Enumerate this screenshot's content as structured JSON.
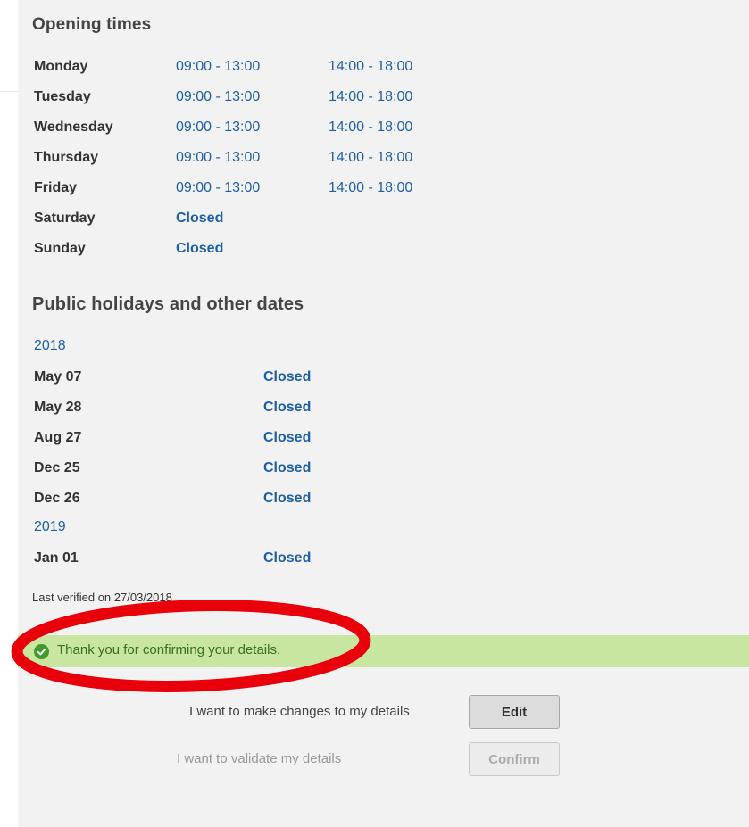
{
  "opening_times": {
    "title": "Opening times",
    "days": [
      {
        "day": "Monday",
        "morning": "09:00 - 13:00",
        "afternoon": "14:00 - 18:00"
      },
      {
        "day": "Tuesday",
        "morning": "09:00 - 13:00",
        "afternoon": "14:00 - 18:00"
      },
      {
        "day": "Wednesday",
        "morning": "09:00 - 13:00",
        "afternoon": "14:00 - 18:00"
      },
      {
        "day": "Thursday",
        "morning": "09:00 - 13:00",
        "afternoon": "14:00 - 18:00"
      },
      {
        "day": "Friday",
        "morning": "09:00 - 13:00",
        "afternoon": "14:00 - 18:00"
      },
      {
        "day": "Saturday",
        "status": "Closed"
      },
      {
        "day": "Sunday",
        "status": "Closed"
      }
    ]
  },
  "public_holidays": {
    "title": "Public holidays and other dates",
    "years": [
      {
        "year": "2018",
        "dates": [
          {
            "date": "May 07",
            "status": "Closed"
          },
          {
            "date": "May 28",
            "status": "Closed"
          },
          {
            "date": "Aug 27",
            "status": "Closed"
          },
          {
            "date": "Dec 25",
            "status": "Closed"
          },
          {
            "date": "Dec 26",
            "status": "Closed"
          }
        ]
      },
      {
        "year": "2019",
        "dates": [
          {
            "date": "Jan 01",
            "status": "Closed"
          }
        ]
      }
    ]
  },
  "last_verified": "Last verified on 27/03/2018",
  "success_message": {
    "icon": "check-circle-icon",
    "text": "Thank you for confirming your details.",
    "background": "#c8e6a0",
    "icon_color": "#3f9a2c"
  },
  "annotation": {
    "shape": "ellipse",
    "color": "#e8000b"
  },
  "actions": {
    "edit_label": "I want to make changes to my details",
    "edit_button": "Edit",
    "confirm_label": "I want to validate my details",
    "confirm_button": "Confirm"
  },
  "colors": {
    "link_blue": "#1d5fa5",
    "panel_bg": "#f2f2f2"
  }
}
